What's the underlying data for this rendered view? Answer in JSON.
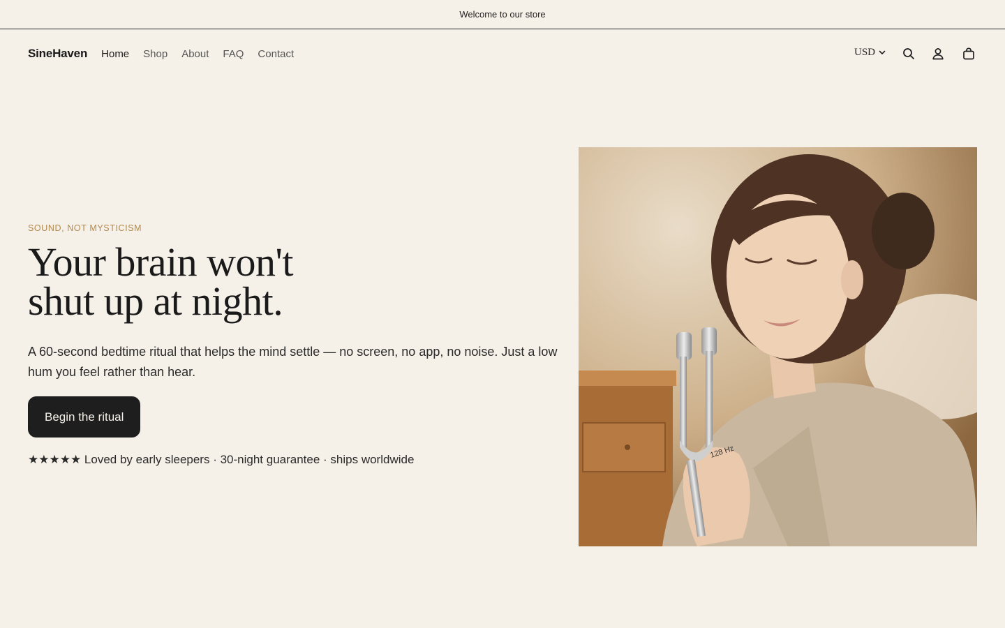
{
  "announcement": {
    "text": "Welcome to our store"
  },
  "header": {
    "logo": "SineHaven",
    "nav": [
      {
        "label": "Home",
        "active": true
      },
      {
        "label": "Shop"
      },
      {
        "label": "About"
      },
      {
        "label": "FAQ"
      },
      {
        "label": "Contact"
      }
    ],
    "currency": "USD",
    "icons": [
      "search-icon",
      "account-icon",
      "cart-icon"
    ]
  },
  "hero": {
    "eyebrow": "SOUND, NOT MYSTICISM",
    "headline_line1": "Your brain won't",
    "headline_line2": "shut up at night.",
    "subtext": "A 60-second bedtime ritual that helps the mind settle — no screen, no app, no noise. Just a low hum you feel rather than hear.",
    "cta_label": "Begin the ritual",
    "trust_line": "★★★★★ Loved by early sleepers · 30-night guarantee · ships worldwide",
    "image": {
      "fork_label": "128 Hz"
    }
  },
  "colors": {
    "background": "#f5f0e8",
    "accent": "#b28a4e",
    "button": "#1e1e1e"
  }
}
